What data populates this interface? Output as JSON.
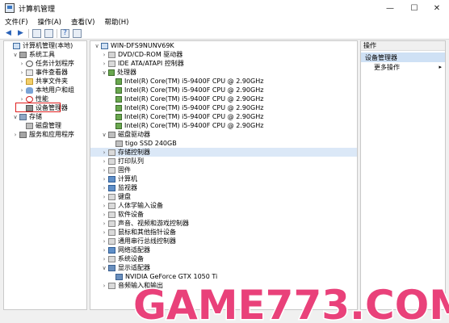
{
  "window": {
    "title": "计算机管理",
    "minimize": "—",
    "maximize": "☐",
    "close": "✕"
  },
  "menu": [
    "文件(F)",
    "操作(A)",
    "查看(V)",
    "帮助(H)"
  ],
  "toolbar": [
    "back-arrow-icon",
    "forward-arrow-icon",
    "folder-up-icon",
    "properties-icon",
    "help-icon",
    "monitor-icon"
  ],
  "left_tree": [
    {
      "label": "计算机管理(本地)",
      "indent": 0,
      "icon": "pc",
      "exp": ""
    },
    {
      "label": "系统工具",
      "indent": 1,
      "icon": "tools",
      "exp": "∨"
    },
    {
      "label": "任务计划程序",
      "indent": 2,
      "icon": "clock",
      "exp": "›"
    },
    {
      "label": "事件查看器",
      "indent": 2,
      "icon": "log",
      "exp": "›"
    },
    {
      "label": "共享文件夹",
      "indent": 2,
      "icon": "folder",
      "exp": "›"
    },
    {
      "label": "本地用户和组",
      "indent": 2,
      "icon": "users",
      "exp": "›"
    },
    {
      "label": "性能",
      "indent": 2,
      "icon": "perf",
      "exp": "›"
    },
    {
      "label": "设备管理器",
      "indent": 2,
      "icon": "dev",
      "exp": ""
    },
    {
      "label": "存储",
      "indent": 1,
      "icon": "store",
      "exp": "∨"
    },
    {
      "label": "磁盘管理",
      "indent": 2,
      "icon": "disk",
      "exp": ""
    },
    {
      "label": "服务和应用程序",
      "indent": 1,
      "icon": "tools",
      "exp": "›"
    }
  ],
  "device_tree": [
    {
      "label": "WIN-DFS9NUNV69K",
      "indent": 0,
      "icon": "pc",
      "exp": "∨"
    },
    {
      "label": "DVD/CD-ROM 驱动器",
      "indent": 1,
      "icon": "drive",
      "exp": "›"
    },
    {
      "label": "IDE ATA/ATAPI 控制器",
      "indent": 1,
      "icon": "chip",
      "exp": "›"
    },
    {
      "label": "处理器",
      "indent": 1,
      "icon": "cpu",
      "exp": "∨"
    },
    {
      "label": "Intel(R) Core(TM) i5-9400F CPU @ 2.90GHz",
      "indent": 2,
      "icon": "cpu",
      "exp": ""
    },
    {
      "label": "Intel(R) Core(TM) i5-9400F CPU @ 2.90GHz",
      "indent": 2,
      "icon": "cpu",
      "exp": ""
    },
    {
      "label": "Intel(R) Core(TM) i5-9400F CPU @ 2.90GHz",
      "indent": 2,
      "icon": "cpu",
      "exp": ""
    },
    {
      "label": "Intel(R) Core(TM) i5-9400F CPU @ 2.90GHz",
      "indent": 2,
      "icon": "cpu",
      "exp": ""
    },
    {
      "label": "Intel(R) Core(TM) i5-9400F CPU @ 2.90GHz",
      "indent": 2,
      "icon": "cpu",
      "exp": ""
    },
    {
      "label": "Intel(R) Core(TM) i5-9400F CPU @ 2.90GHz",
      "indent": 2,
      "icon": "cpu",
      "exp": ""
    },
    {
      "label": "磁盘驱动器",
      "indent": 1,
      "icon": "disk",
      "exp": "∨"
    },
    {
      "label": "tigo SSD 240GB",
      "indent": 2,
      "icon": "disk",
      "exp": ""
    },
    {
      "label": "存储控制器",
      "indent": 1,
      "icon": "chip",
      "exp": "›",
      "hl": true
    },
    {
      "label": "打印队列",
      "indent": 1,
      "icon": "chip",
      "exp": "›"
    },
    {
      "label": "固件",
      "indent": 1,
      "icon": "chip",
      "exp": "›"
    },
    {
      "label": "计算机",
      "indent": 1,
      "icon": "monitor",
      "exp": "›"
    },
    {
      "label": "监视器",
      "indent": 1,
      "icon": "monitor",
      "exp": "›"
    },
    {
      "label": "键盘",
      "indent": 1,
      "icon": "chip",
      "exp": "›"
    },
    {
      "label": "人体学输入设备",
      "indent": 1,
      "icon": "chip",
      "exp": "›"
    },
    {
      "label": "软件设备",
      "indent": 1,
      "icon": "chip",
      "exp": "›"
    },
    {
      "label": "声音、视频和游戏控制器",
      "indent": 1,
      "icon": "chip",
      "exp": "›"
    },
    {
      "label": "鼠标和其他指针设备",
      "indent": 1,
      "icon": "chip",
      "exp": "›"
    },
    {
      "label": "通用串行总线控制器",
      "indent": 1,
      "icon": "chip",
      "exp": "›"
    },
    {
      "label": "网络适配器",
      "indent": 1,
      "icon": "monitor",
      "exp": "›"
    },
    {
      "label": "系统设备",
      "indent": 1,
      "icon": "chip",
      "exp": "›"
    },
    {
      "label": "显示适配器",
      "indent": 1,
      "icon": "gpu",
      "exp": "∨"
    },
    {
      "label": "NVIDIA GeForce GTX 1050 Ti",
      "indent": 2,
      "icon": "gpu",
      "exp": ""
    },
    {
      "label": "音频输入和输出",
      "indent": 1,
      "icon": "chip",
      "exp": "›"
    }
  ],
  "actions": {
    "header": "操作",
    "selected": "设备管理器",
    "more": "更多操作",
    "more_arrow": "▸"
  },
  "watermark": {
    "text": "GAME773.COM",
    "color": "#e9417a"
  }
}
